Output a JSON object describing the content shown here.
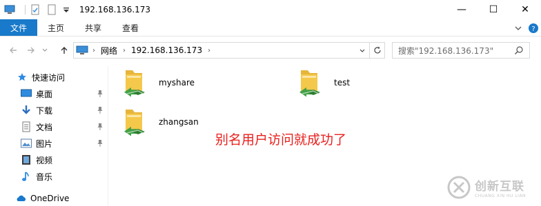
{
  "window": {
    "title": "192.168.136.173",
    "controls": {
      "minimize": "—",
      "maximize": "☐",
      "close": "✕"
    }
  },
  "ribbon": {
    "tabs": [
      {
        "label": "文件",
        "active": true
      },
      {
        "label": "主页",
        "active": false
      },
      {
        "label": "共享",
        "active": false
      },
      {
        "label": "查看",
        "active": false
      }
    ]
  },
  "address": {
    "breadcrumb": [
      "网络",
      "192.168.136.173"
    ],
    "search_placeholder": "搜索\"192.168.136.173\""
  },
  "sidebar": {
    "items": [
      {
        "label": "快速访问",
        "icon": "star-icon",
        "pinned": false
      },
      {
        "label": "桌面",
        "icon": "desktop-icon",
        "pinned": true
      },
      {
        "label": "下载",
        "icon": "download-icon",
        "pinned": true
      },
      {
        "label": "文档",
        "icon": "documents-icon",
        "pinned": true
      },
      {
        "label": "图片",
        "icon": "pictures-icon",
        "pinned": true
      },
      {
        "label": "视频",
        "icon": "videos-icon",
        "pinned": false
      },
      {
        "label": "音乐",
        "icon": "music-icon",
        "pinned": false
      },
      {
        "label": "OneDrive",
        "icon": "cloud-icon",
        "pinned": false
      }
    ]
  },
  "shares": [
    {
      "name": "myshare"
    },
    {
      "name": "test"
    },
    {
      "name": "zhangsan"
    }
  ],
  "annotation": "别名用户访问就成功了",
  "watermark": {
    "brand": "创新互联",
    "subtitle": "CHUANG XIN HU LIAN"
  },
  "colors": {
    "accent": "#1979ca",
    "annotation": "#e8201d",
    "folder": "#f4c84a",
    "share_arrow": "#43a047"
  }
}
